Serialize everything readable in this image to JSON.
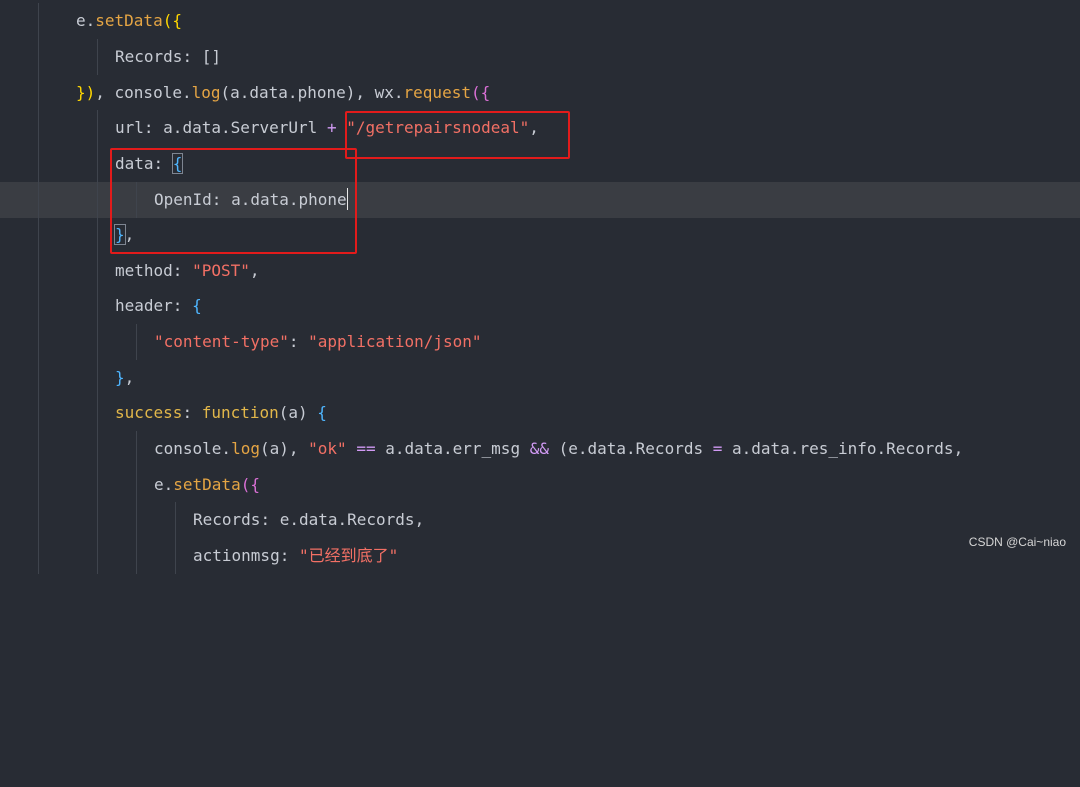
{
  "editor": {
    "lines": [
      [
        "e.",
        "setData",
        "({"
      ],
      [
        "Records",
        ": []"
      ],
      [
        "})",
        ", console.",
        "log",
        "(a.data.phone), wx.",
        "request",
        "({"
      ],
      [
        "url",
        ": a.data.ServerUrl ",
        "+",
        " ",
        "\"/getrepairsnodeal\"",
        ","
      ],
      [
        "data",
        ": ",
        "{"
      ],
      [
        "OpenId",
        ": a.data.phone"
      ],
      [
        "}",
        ","
      ],
      [
        "method",
        ": ",
        "\"POST\"",
        ","
      ],
      [
        "header",
        ": ",
        "{"
      ],
      [
        "\"content-type\"",
        ": ",
        "\"application/json\""
      ],
      [
        "}",
        ","
      ],
      [
        "success",
        ": ",
        "function",
        "(a) ",
        "{"
      ],
      [
        "console.",
        "log",
        "(a), ",
        "\"ok\"",
        " ",
        "==",
        " a.data.err_msg ",
        "&&",
        " (e.data.Records ",
        "=",
        " a.data.res_info.Records,"
      ],
      [
        "e.",
        "setData",
        "({"
      ],
      [
        "Records",
        ": e.data.Records,"
      ],
      [
        "actionmsg",
        ": ",
        "\"已经到底了\""
      ]
    ]
  },
  "watermark": "CSDN @Cai~niao"
}
